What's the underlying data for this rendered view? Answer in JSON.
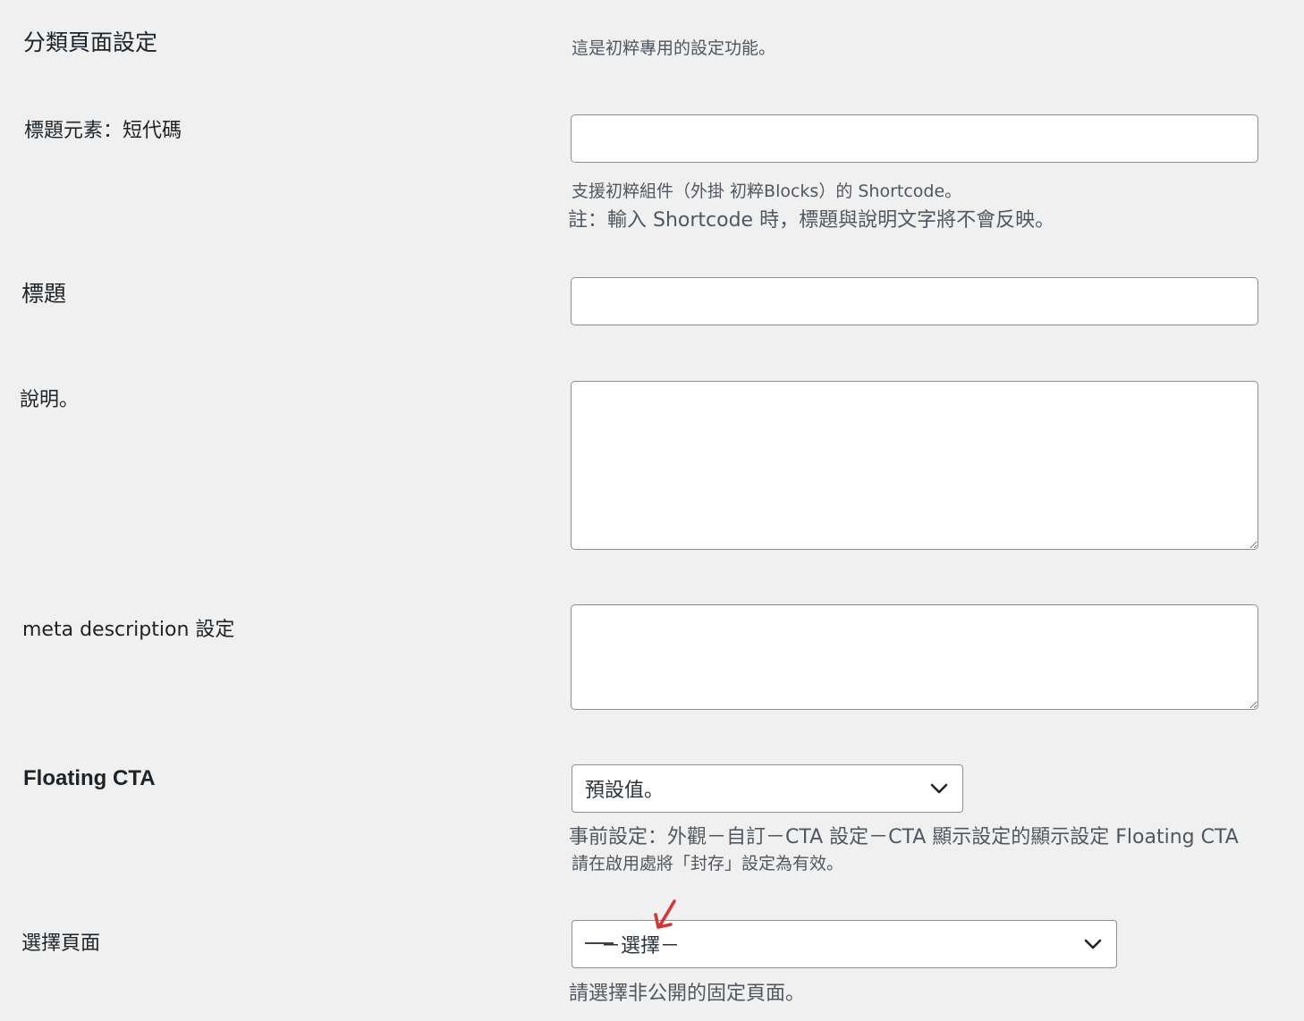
{
  "section": {
    "title": "分類頁面設定",
    "note": "這是初粹專用的設定功能。"
  },
  "fields": {
    "title_shortcode": {
      "label": "標題元素：短代碼",
      "value": "",
      "help_line1": "支援初粹組件（外掛 初粹Blocks）的 Shortcode。",
      "help_line2": "註：輸入 Shortcode 時，標題與說明文字將不會反映。"
    },
    "title": {
      "label": "標題",
      "value": ""
    },
    "description": {
      "label": "說明。",
      "value": ""
    },
    "meta_description": {
      "label": "meta description 設定",
      "value": ""
    },
    "floating_cta": {
      "label": "Floating CTA",
      "selected": "預設值。",
      "help_line1": "事前設定：外觀－自訂－CTA 設定－CTA 顯示設定的顯示設定 Floating CTA",
      "help_line2": "請在啟用處將「封存」設定為有效。"
    },
    "select_page": {
      "label": "選擇頁面",
      "selected": "－選擇－",
      "help": "請選擇非公開的固定頁面。"
    }
  },
  "icons": {
    "chevron": "chevron-down-icon",
    "annotation": "red-arrow-annotation-icon"
  },
  "colors": {
    "background": "#f0f0f1",
    "border": "#8c8f94",
    "help_text": "#50575e",
    "annotation": "#d63638"
  }
}
